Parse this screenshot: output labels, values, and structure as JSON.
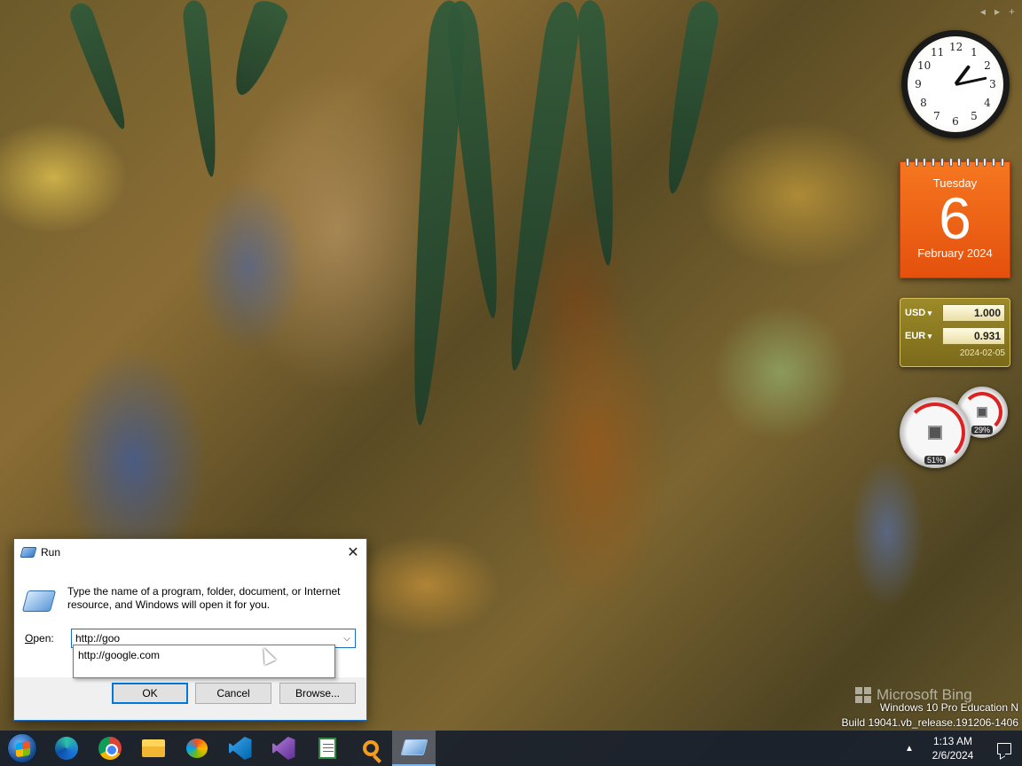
{
  "gadget_nav": {
    "prev": "◂",
    "next": "▸",
    "add": "+"
  },
  "clock": {
    "numbers": [
      "12",
      "1",
      "2",
      "3",
      "4",
      "5",
      "6",
      "7",
      "8",
      "9",
      "10",
      "11"
    ],
    "time": "1:13"
  },
  "calendar": {
    "weekday": "Tuesday",
    "day": "6",
    "month_year": "February 2024"
  },
  "currency": {
    "rows": [
      {
        "code": "USD",
        "value": "1.000"
      },
      {
        "code": "EUR",
        "value": "0.931"
      }
    ],
    "date": "2024-02-05"
  },
  "meters": {
    "cpu_percent": "51%",
    "memory_percent": "29%"
  },
  "watermark": {
    "brand": "Microsoft Bing",
    "os_edition": "Windows 10 Pro Education N",
    "build": "Build 19041.vb_release.191206-1406"
  },
  "run_dialog": {
    "title": "Run",
    "close_glyph": "✕",
    "description": "Type the name of a program, folder, document, or Internet resource, and Windows will open it for you.",
    "open_label": "Open:",
    "open_value": "http://goo",
    "dropdown_glyph": "⌵",
    "suggestion": "http://google.com",
    "ok_label": "OK",
    "cancel_label": "Cancel",
    "browse_label": "Browse..."
  },
  "taskbar": {
    "apps": [
      {
        "name": "edge-icon"
      },
      {
        "name": "chrome-icon"
      },
      {
        "name": "file-explorer-icon"
      },
      {
        "name": "paint-3d-icon"
      },
      {
        "name": "vscode-icon"
      },
      {
        "name": "visual-studio-icon"
      },
      {
        "name": "notepad-plus-plus-icon"
      },
      {
        "name": "search-everything-icon"
      },
      {
        "name": "run-icon"
      }
    ],
    "tray_chevron": "▲",
    "time": "1:13 AM",
    "date": "2/6/2024"
  }
}
